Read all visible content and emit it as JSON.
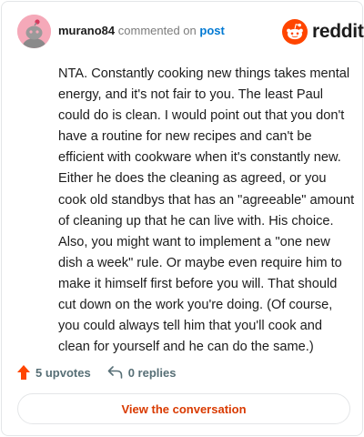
{
  "header": {
    "username": "murano84",
    "commented_text": "commented on",
    "post_link": "post"
  },
  "logo": {
    "text": "reddit",
    "icon": "reddit-snoo-icon"
  },
  "comment": {
    "text": "NTA. Constantly cooking new things takes mental energy, and it's not fair to you. The least Paul could do is clean. I would point out that you don't have a routine for new recipes and can't be efficient with cookware when it's constantly new. Either he does the cleaning as agreed, or you cook old standbys that has an \"agreeable\" amount of cleaning up that he can live with. His choice. Also, you might want to implement a \"one new dish a week\" rule. Or maybe even require him to make it himself first before you will. That should cut down on the work you're doing. (Of course, you could always tell him that you'll cook and clean for yourself and he can do the same.)"
  },
  "actions": {
    "upvotes": "5 upvotes",
    "replies": "0 replies"
  },
  "view_button": {
    "label": "View the conversation"
  },
  "colors": {
    "brand": "#ff4500",
    "upvote": "#ff4500",
    "link": "#0079d3",
    "button_text": "#d93a00",
    "avatar_bg": "#f5a9b9"
  }
}
